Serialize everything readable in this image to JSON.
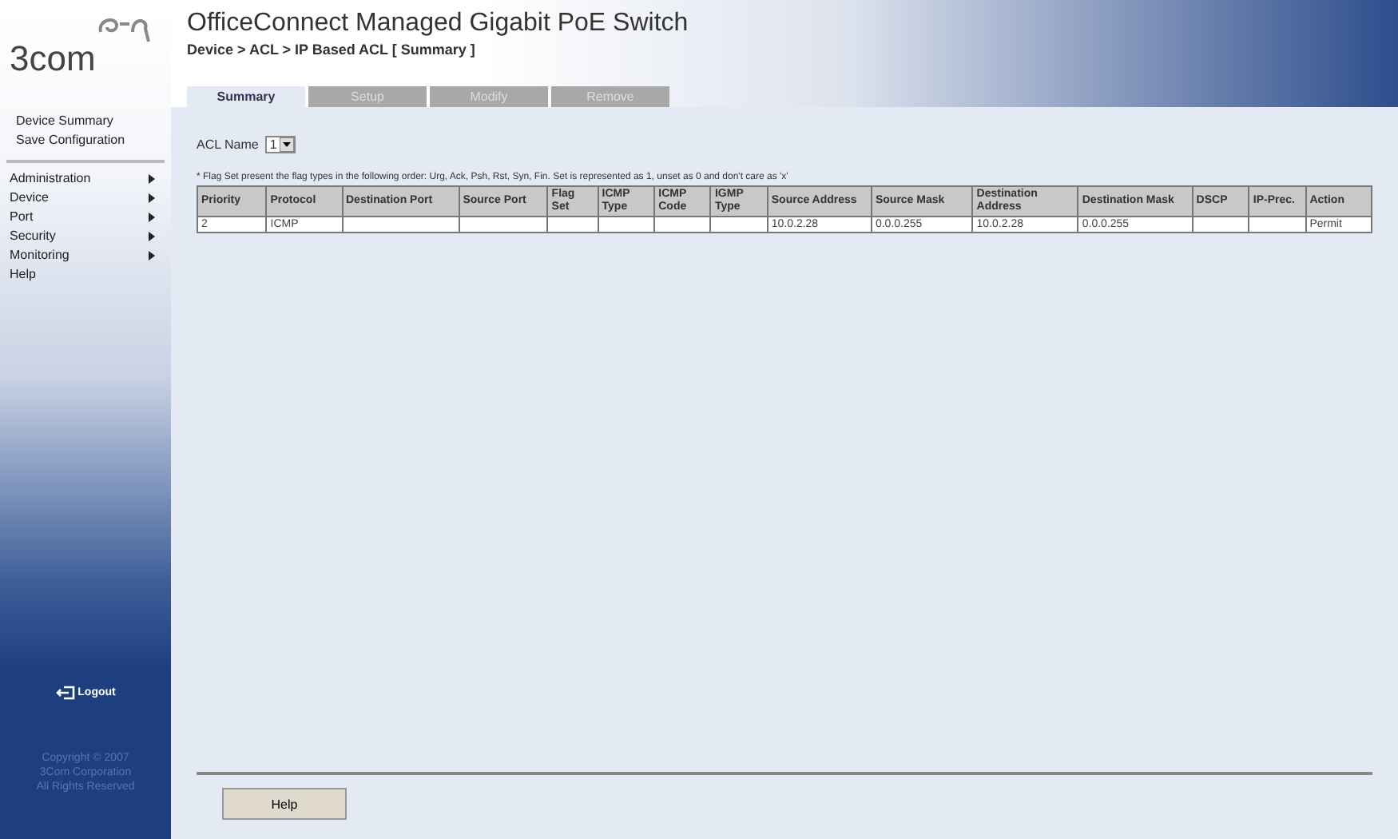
{
  "header": {
    "logo": "3com",
    "title": "OfficeConnect Managed Gigabit PoE Switch",
    "breadcrumb": "Device > ACL > IP Based ACL [ Summary ]"
  },
  "tabs": [
    {
      "label": "Summary",
      "selected": true
    },
    {
      "label": "Setup",
      "selected": false
    },
    {
      "label": "Modify",
      "selected": false
    },
    {
      "label": "Remove",
      "selected": false
    }
  ],
  "sidebar": {
    "top_items": [
      "Device Summary",
      "Save Configuration"
    ],
    "menu": [
      {
        "label": "Administration",
        "submenu": true
      },
      {
        "label": "Device",
        "submenu": true
      },
      {
        "label": "Port",
        "submenu": true
      },
      {
        "label": "Security",
        "submenu": true
      },
      {
        "label": "Monitoring",
        "submenu": true
      },
      {
        "label": "Help",
        "submenu": false
      }
    ],
    "logout": "Logout",
    "copyright": [
      "Copyright © 2007",
      "3Com Corporation",
      "All Rights Reserved"
    ]
  },
  "acl_name": {
    "label": "ACL Name",
    "value": "1"
  },
  "note": "* Flag Set present the flag types in the following order: Urg, Ack, Psh, Rst, Syn, Fin. Set is represented as 1, unset as 0 and don't care as 'x'",
  "table": {
    "columns": [
      "Priority",
      "Protocol",
      "Destination Port",
      "Source Port",
      "Flag Set",
      "ICMP Type",
      "ICMP Code",
      "IGMP Type",
      "Source Address",
      "Source Mask",
      "Destination Address",
      "Destination Mask",
      "DSCP",
      "IP-Prec.",
      "Action"
    ],
    "rows": [
      [
        "2",
        "ICMP",
        "",
        "",
        "",
        "",
        "",
        "",
        "10.0.2.28",
        "0.0.0.255",
        "10.0.2.28",
        "0.0.0.255",
        "",
        "",
        "Permit"
      ]
    ]
  },
  "help_button": "Help"
}
